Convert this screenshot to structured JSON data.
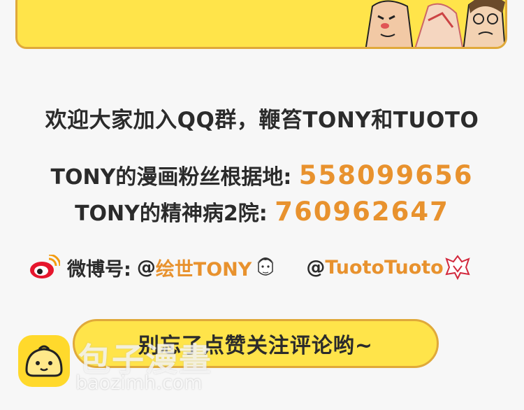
{
  "intro": {
    "line": "欢迎大家加入QQ群，鞭笞TONY和TUOTO"
  },
  "groups": [
    {
      "label": "TONY的漫画粉丝根据地:",
      "number": "558099656"
    },
    {
      "label": "TONY的精神病2院:",
      "number": "760962647"
    }
  ],
  "weibo": {
    "icon": "weibo-icon",
    "label": "微博号:",
    "at1": "@",
    "handle1": "绘世TONY",
    "at2": "@",
    "handle2": "TuotoTuoto"
  },
  "cta": {
    "label": "别忘了点赞关注评论哟~"
  },
  "watermark": {
    "title": "包子漫畫",
    "url": "baozimh.com"
  },
  "colors": {
    "accent": "#e8922e",
    "banner": "#ffe44a",
    "border": "#e0a93a"
  }
}
